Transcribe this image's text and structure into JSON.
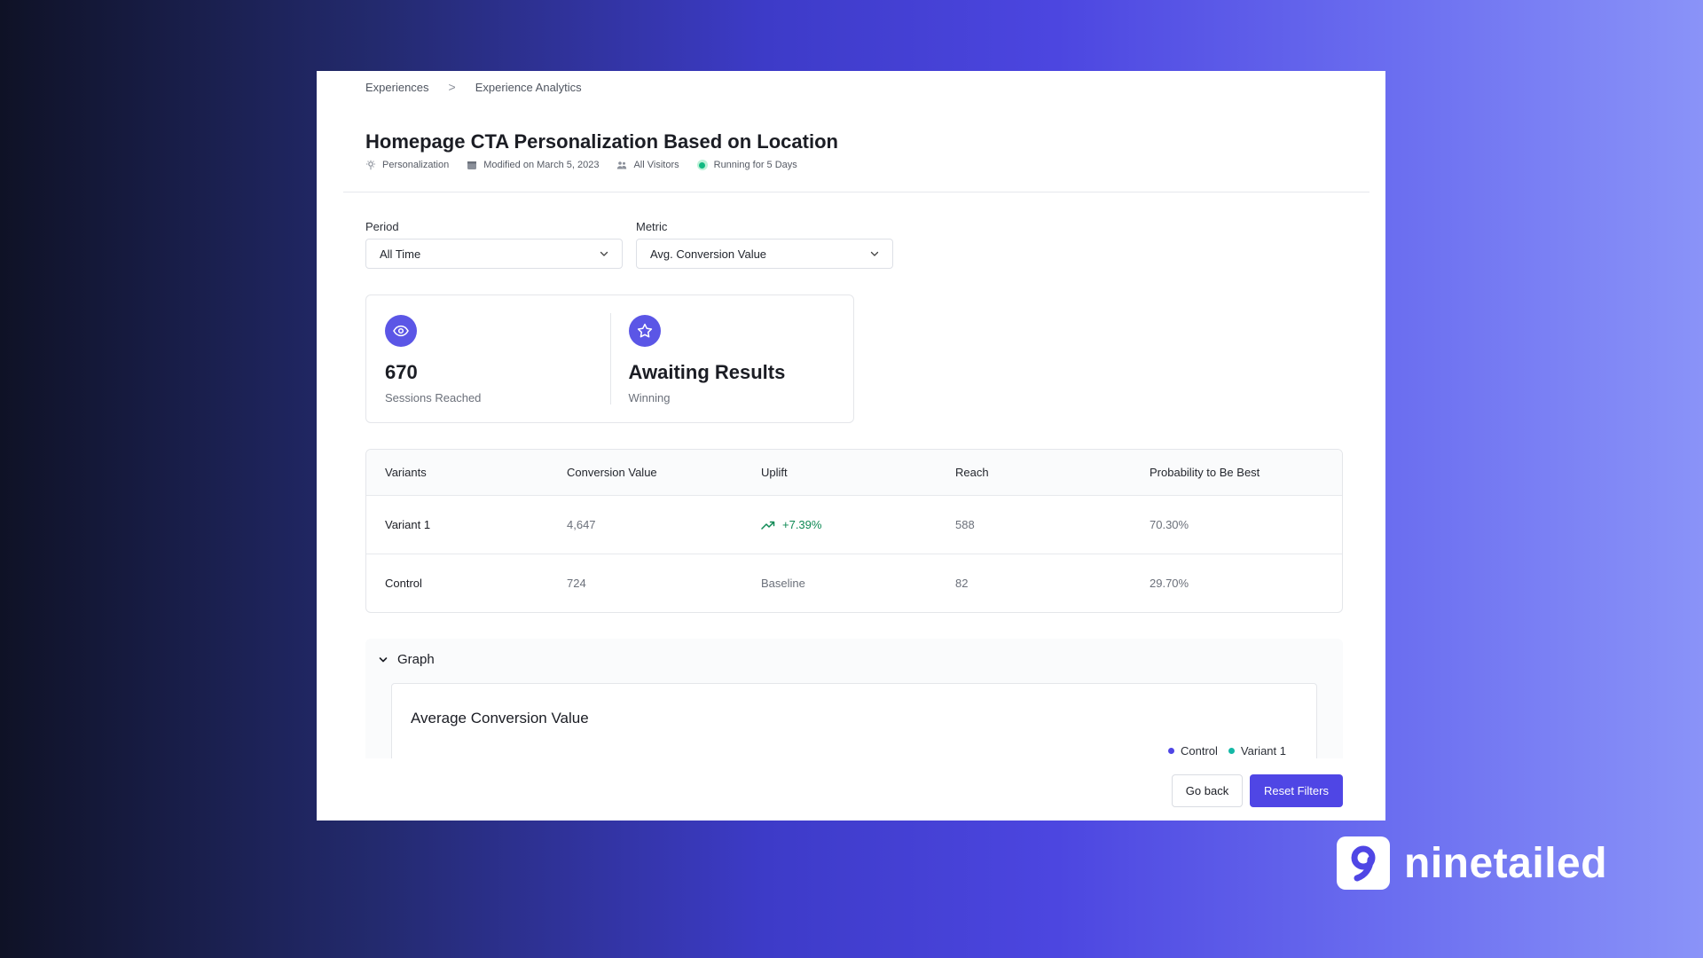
{
  "breadcrumb": {
    "items": [
      "Experiences",
      "Experience Analytics"
    ],
    "separator": ">"
  },
  "experience": {
    "title": "Homepage CTA Personalization Based on Location",
    "type": "Personalization",
    "modified": "Modified on March 5, 2023",
    "audience": "All Visitors",
    "status": "Running for 5 Days"
  },
  "filters": {
    "period": {
      "label": "Period",
      "value": "All Time"
    },
    "metric": {
      "label": "Metric",
      "value": "Avg. Conversion Value"
    }
  },
  "stats": [
    {
      "icon": "eye-icon",
      "value": "670",
      "label": "Sessions Reached"
    },
    {
      "icon": "star-icon",
      "value": "Awaiting Results",
      "label": "Winning"
    }
  ],
  "table": {
    "headers": [
      "Variants",
      "Conversion Value",
      "Uplift",
      "Reach",
      "Probability to Be Best"
    ],
    "rows": [
      {
        "variant": "Variant 1",
        "conversion": "4,647",
        "uplift": "+7.39%",
        "reach": "588",
        "probability": "70.30%"
      },
      {
        "variant": "Control",
        "conversion": "724",
        "uplift": "Baseline",
        "reach": "82",
        "probability": "29.70%"
      }
    ]
  },
  "graph": {
    "toggle_label": "Graph",
    "title": "Average Conversion Value",
    "legend": [
      {
        "name": "Control",
        "color": "#4f46e5"
      },
      {
        "name": "Variant 1",
        "color": "#14b8a6"
      }
    ]
  },
  "actions": {
    "back_label": "Go back",
    "reset_label": "Reset Filters"
  },
  "brand": {
    "name": "ninetailed"
  },
  "colors": {
    "accent": "#4f46e5",
    "success": "#10b981",
    "uplift": "#0f8a55"
  }
}
